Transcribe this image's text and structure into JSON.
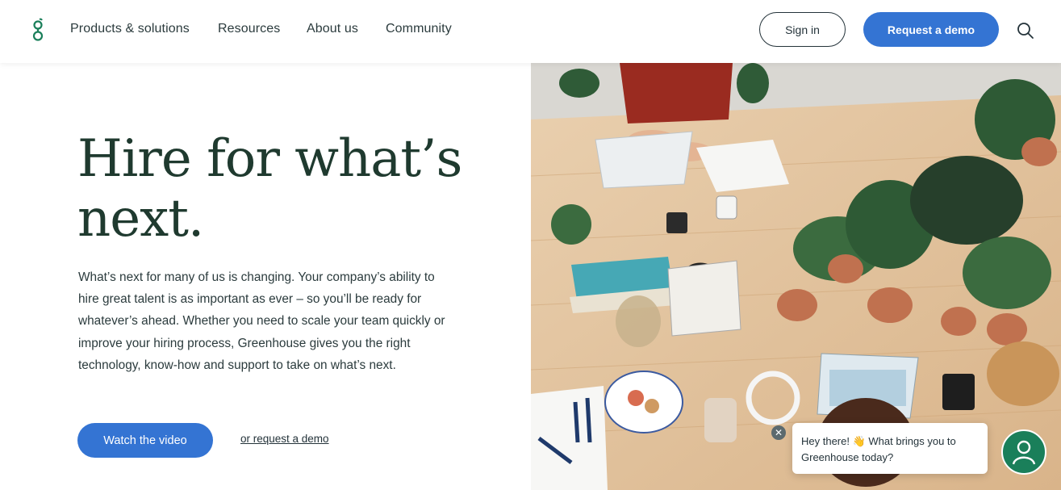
{
  "header": {
    "logo_icon": "greenhouse-g-logo",
    "nav": [
      "Products & solutions",
      "Resources",
      "About us",
      "Community"
    ],
    "sign_in": "Sign in",
    "request_demo": "Request a demo",
    "search_icon": "search-icon"
  },
  "hero": {
    "title": "Hire for what’s next.",
    "body": "What’s next for many of us is changing. Your company’s ability to hire great talent is as important as ever – so you’ll be ready for whatever’s ahead. Whether you need to scale your team quickly or improve your hiring process, Greenhouse gives you the right technology, know-how and support to take on what’s next.",
    "watch_video": "Watch the video",
    "request_demo_link": "or request a demo"
  },
  "chat": {
    "message": "Hey there! 👋 What brings you to Greenhouse today?",
    "close_icon": "close-icon",
    "avatar_icon": "person-icon"
  },
  "colors": {
    "accent": "#3474d3",
    "heading": "#1f3a2f",
    "brand_green": "#1a7f5a"
  }
}
